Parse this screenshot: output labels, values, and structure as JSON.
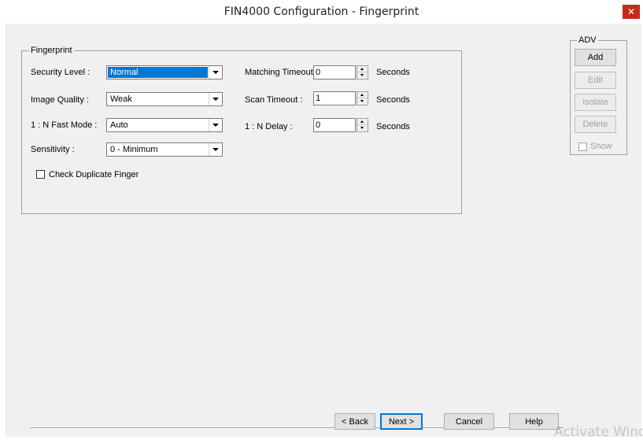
{
  "window": {
    "title": "FIN4000 Configuration - Fingerprint",
    "close_label": "✕"
  },
  "fingerprint_group": {
    "title": "Fingerprint",
    "security_level": {
      "label": "Security Level :",
      "value": "Normal"
    },
    "image_quality": {
      "label": "Image Quality :",
      "value": "Weak"
    },
    "fast_mode": {
      "label": "1 : N Fast Mode :",
      "value": "Auto"
    },
    "sensitivity": {
      "label": "Sensitivity :",
      "value": "0 - Minimum"
    },
    "matching_timeout": {
      "label": "Matching Timeout :",
      "value": "0",
      "unit": "Seconds"
    },
    "scan_timeout": {
      "label": "Scan Timeout :",
      "value": "1",
      "unit": "Seconds"
    },
    "n_delay": {
      "label": "1 : N Delay :",
      "value": "0",
      "unit": "Seconds"
    },
    "check_duplicate": {
      "label": "Check Duplicate Finger",
      "checked": false
    }
  },
  "adv_group": {
    "title": "ADV",
    "add": "Add",
    "edit": "Edit",
    "isolate": "Isolate",
    "delete": "Delete",
    "show": {
      "label": "Show",
      "checked": false,
      "enabled": false
    }
  },
  "footer": {
    "back": "< Back",
    "next": "Next >",
    "cancel": "Cancel",
    "help": "Help"
  },
  "watermark": "Activate Wind",
  "colors": {
    "selection": "#0078d7",
    "close_button": "#c42b1c",
    "dialog_background": "#f0f0f0"
  }
}
